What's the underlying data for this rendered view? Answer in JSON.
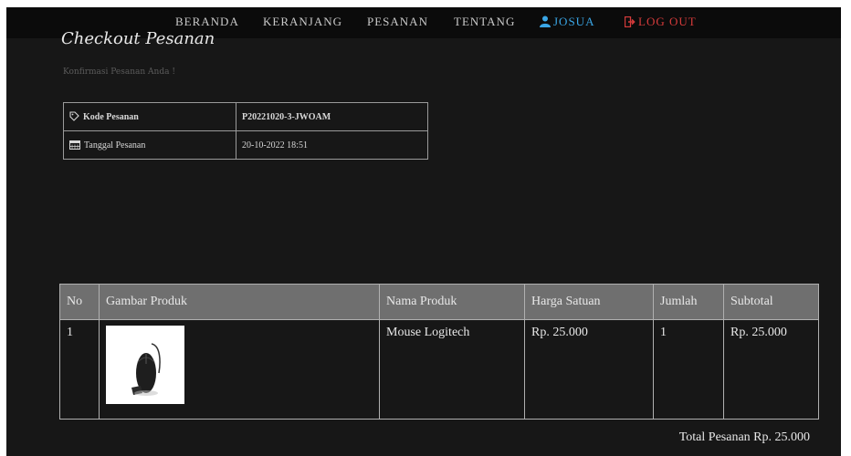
{
  "nav": {
    "items": [
      "BERANDA",
      "KERANJANG",
      "PESANAN",
      "TENTANG"
    ],
    "user": "JOSUA",
    "logout": "LOG OUT",
    "icons": [
      "user-icon",
      "logout-icon"
    ],
    "colors": {
      "user": "#3aa6e6",
      "logout": "#d63b3b"
    }
  },
  "page": {
    "title": "Checkout Pesanan",
    "subtitle": "Konfirmasi Pesanan Anda !"
  },
  "info": {
    "rows": [
      {
        "label": "Kode Pesanan",
        "value": "P20221020-3-JWOAM",
        "icon": "tag-icon"
      },
      {
        "label": "Tanggal Pesanan",
        "value": "20-10-2022 18:51",
        "icon": "calendar-icon"
      }
    ]
  },
  "table": {
    "headers": [
      "No",
      "Gambar Produk",
      "Nama Produk",
      "Harga Satuan",
      "Jumlah",
      "Subtotal"
    ],
    "rows": [
      {
        "no": "1",
        "image": "mouse-image",
        "name": "Mouse Logitech",
        "price": "Rp. 25.000",
        "qty": "1",
        "subtotal": "Rp. 25.000"
      }
    ]
  },
  "total": "Total Pesanan Rp. 25.000"
}
